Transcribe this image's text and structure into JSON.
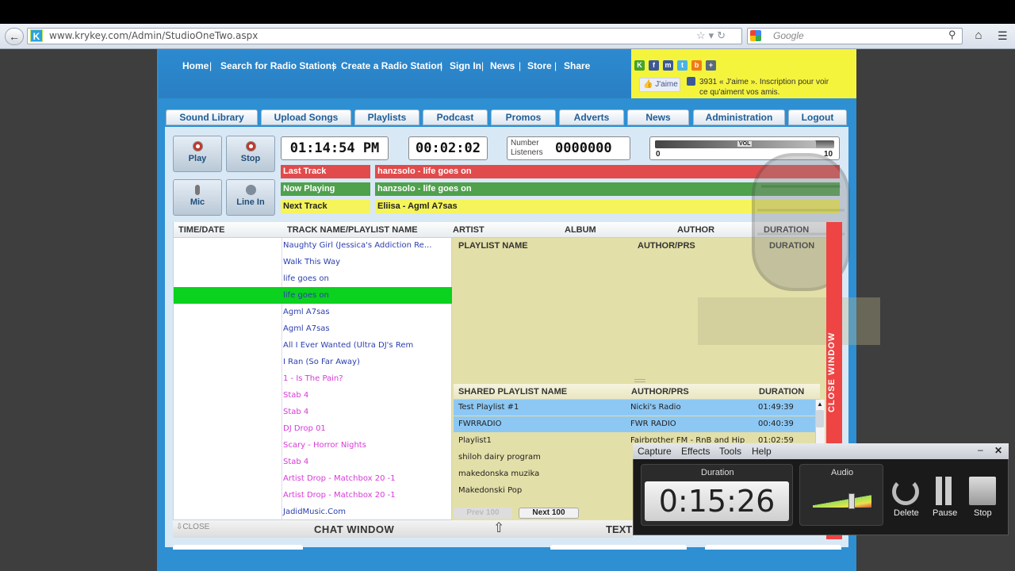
{
  "browser": {
    "url": "www.krykey.com/Admin/StudioOneTwo.aspx",
    "search_placeholder": "Google",
    "favicon_letter": "K"
  },
  "site_nav": [
    "Home",
    "Search for Radio Stations",
    "Create a Radio Station",
    "Sign In",
    "News",
    "Store",
    "Share"
  ],
  "facebook": {
    "like_label": "J'aime",
    "text": "3931 « J'aime ». Inscription pour voir ce qu'aiment vos amis."
  },
  "tabs": [
    "Sound Library",
    "Upload Songs",
    "Playlists",
    "Podcast",
    "Promos",
    "Adverts",
    "News",
    "Administration",
    "Logout"
  ],
  "controls": {
    "play": "Play",
    "stop": "Stop",
    "mic": "Mic",
    "line_in": "Line In",
    "clock": "01:14:54 PM",
    "elapsed": "00:02:02",
    "listeners_label": "Number Listeners",
    "listeners_value": "0000000",
    "volume": {
      "label": "VOL",
      "min": "0",
      "max": "10",
      "level": 0.9
    }
  },
  "tracks": {
    "last_label": "Last Track",
    "last_value": "hanzsolo - life goes on",
    "now_label": "Now Playing",
    "now_value": "hanzsolo - life goes on",
    "next_label": "Next Track",
    "next_value": "Eliisa - Agml A7sas"
  },
  "history": {
    "columns": [
      "TIME/DATE",
      "TRACK NAME/PLAYLIST NAME"
    ],
    "rows": [
      {
        "name": "Naughty Girl (Jessica's Addiction Re...",
        "color": "#2b3fae"
      },
      {
        "name": "Walk This Way",
        "color": "#2b3fae"
      },
      {
        "name": "life goes on",
        "color": "#2b3fae"
      },
      {
        "name": "life goes on",
        "color": "#2b3fae",
        "highlight": true
      },
      {
        "name": "Agml A7sas",
        "color": "#2b3fae"
      },
      {
        "name": "Agml A7sas",
        "color": "#2b3fae"
      },
      {
        "name": "All I Ever Wanted (Ultra DJ's Rem",
        "color": "#2b3fae"
      },
      {
        "name": "I Ran (So Far Away)",
        "color": "#2b3fae"
      },
      {
        "name": "1 - Is The Pain?",
        "color": "#d63ad6"
      },
      {
        "name": "Stab 4",
        "color": "#d63ad6"
      },
      {
        "name": "Stab 4",
        "color": "#d63ad6"
      },
      {
        "name": "DJ Drop 01",
        "color": "#d63ad6"
      },
      {
        "name": "Scary - Horror Nights",
        "color": "#d63ad6"
      },
      {
        "name": "Stab 4",
        "color": "#d63ad6"
      },
      {
        "name": "Artist Drop - Matchbox 20 -1",
        "color": "#d63ad6"
      },
      {
        "name": "Artist Drop - Matchbox 20 -1",
        "color": "#d63ad6"
      },
      {
        "name": "JadidMusic.Com",
        "color": "#2b3fae"
      }
    ]
  },
  "right_headers": [
    "ARTIST",
    "ALBUM",
    "AUTHOR",
    "DURATION"
  ],
  "playlist_headers": [
    "PLAYLIST NAME",
    "AUTHOR/PRS",
    "DURATION"
  ],
  "shared": {
    "columns": [
      "SHARED PLAYLIST NAME",
      "AUTHOR/PRS",
      "DURATION"
    ],
    "rows": [
      {
        "name": "Test Playlist #1",
        "author": "Nicki's Radio",
        "duration": "01:49:39",
        "sel": true
      },
      {
        "name": "FWRRADIO",
        "author": "FWR RADIO",
        "duration": "00:40:39",
        "sel": true
      },
      {
        "name": "Playlist1",
        "author": "Fairbrother FM - RnB and Hip",
        "duration": "01:02:59"
      },
      {
        "name": "shiloh dairy program",
        "author": "",
        "duration": ""
      },
      {
        "name": "makedonska muzika",
        "author": "",
        "duration": ""
      },
      {
        "name": "Makedonski Pop",
        "author": "",
        "duration": ""
      }
    ],
    "prev": "Prev 100",
    "next": "Next 100"
  },
  "close_window": "CLOSE WINDOW",
  "bottom": {
    "close": "CLOSE",
    "chat": "CHAT WINDOW",
    "text": "TEXT"
  },
  "recorder": {
    "menu": [
      "Capture",
      "Effects",
      "Tools",
      "Help"
    ],
    "duration_label": "Duration",
    "duration": "0:15:26",
    "audio_label": "Audio",
    "delete": "Delete",
    "pause": "Pause",
    "stop": "Stop"
  }
}
